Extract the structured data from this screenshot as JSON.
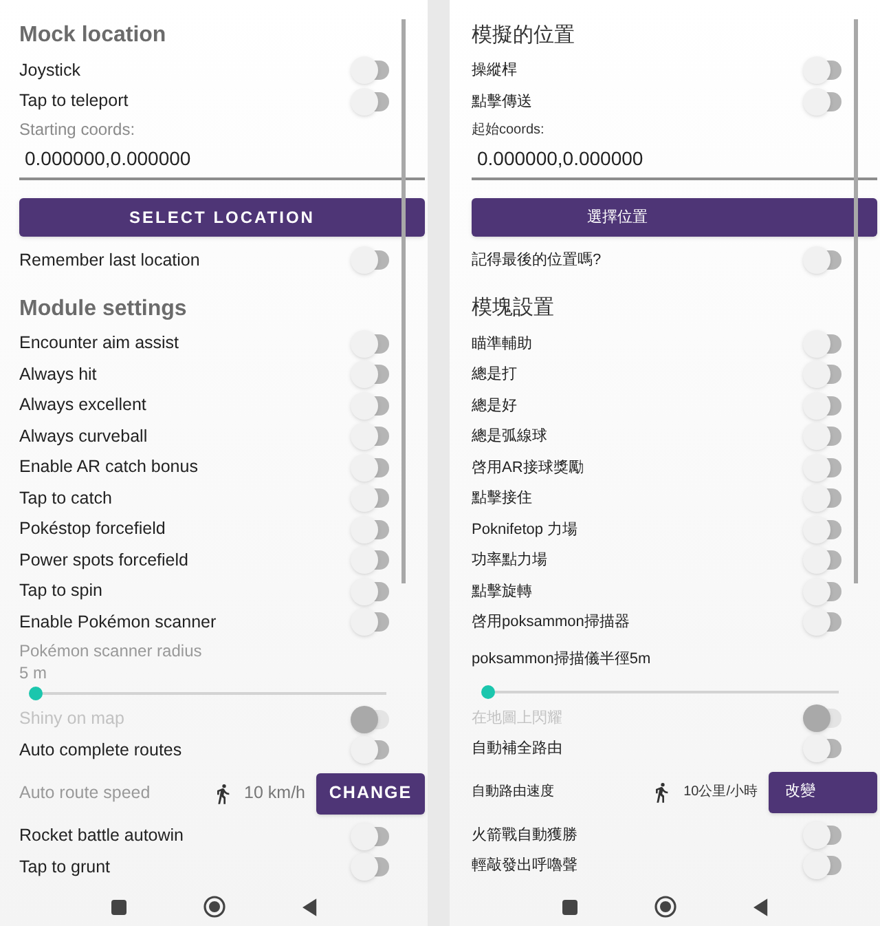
{
  "panels": [
    {
      "items": [
        {
          "kind": "header",
          "text": "Mock location"
        },
        {
          "kind": "toggle",
          "label": "Joystick",
          "on": false,
          "disabled": false
        },
        {
          "kind": "toggle",
          "label": "Tap to teleport",
          "on": false,
          "disabled": false
        },
        {
          "kind": "caption",
          "text": "Starting coords:"
        },
        {
          "kind": "input",
          "value": "0.000000,0.000000"
        },
        {
          "kind": "button",
          "label": "SELECT LOCATION"
        },
        {
          "kind": "toggle",
          "label": "Remember last location",
          "on": false,
          "disabled": false
        },
        {
          "kind": "header",
          "text": "Module settings"
        },
        {
          "kind": "toggle",
          "label": "Encounter aim assist",
          "on": false,
          "disabled": false
        },
        {
          "kind": "toggle",
          "label": "Always hit",
          "on": false,
          "disabled": false
        },
        {
          "kind": "toggle",
          "label": "Always excellent",
          "on": false,
          "disabled": false
        },
        {
          "kind": "toggle",
          "label": "Always curveball",
          "on": false,
          "disabled": false
        },
        {
          "kind": "toggle",
          "label": "Enable AR catch bonus",
          "on": false,
          "disabled": false
        },
        {
          "kind": "toggle",
          "label": "Tap to catch",
          "on": false,
          "disabled": false
        },
        {
          "kind": "toggle",
          "label": "Pokéstop forcefield",
          "on": false,
          "disabled": false
        },
        {
          "kind": "toggle",
          "label": "Power spots forcefield",
          "on": false,
          "disabled": false
        },
        {
          "kind": "toggle",
          "label": "Tap to spin",
          "on": false,
          "disabled": false
        },
        {
          "kind": "toggle",
          "label": "Enable Pokémon scanner",
          "on": false,
          "disabled": false
        },
        {
          "kind": "slider",
          "label": "Pokémon scanner radius",
          "value": "5 m",
          "level": 0
        },
        {
          "kind": "toggle",
          "label": "Shiny on map",
          "on": false,
          "disabled": true
        },
        {
          "kind": "toggle",
          "label": "Auto complete routes",
          "on": false,
          "disabled": false
        },
        {
          "kind": "speed",
          "label": "Auto route speed",
          "value": "10 km/h",
          "button": "CHANGE"
        },
        {
          "kind": "toggle",
          "label": "Rocket battle autowin",
          "on": false,
          "disabled": false
        },
        {
          "kind": "toggle",
          "label": "Tap to grunt",
          "on": false,
          "disabled": false
        }
      ]
    },
    {
      "items": [
        {
          "kind": "header",
          "text": "模擬的位置"
        },
        {
          "kind": "toggle",
          "label": "操縱桿",
          "on": false,
          "disabled": false
        },
        {
          "kind": "toggle",
          "label": "點擊傳送",
          "on": false,
          "disabled": false
        },
        {
          "kind": "caption",
          "text": "起始coords:"
        },
        {
          "kind": "input",
          "value": "0.000000,0.000000"
        },
        {
          "kind": "button",
          "label": "選擇位置"
        },
        {
          "kind": "toggle",
          "label": "記得最後的位置嗎?",
          "on": false,
          "disabled": false
        },
        {
          "kind": "header",
          "text": "模塊設置"
        },
        {
          "kind": "toggle",
          "label": "瞄準輔助",
          "on": false,
          "disabled": false
        },
        {
          "kind": "toggle",
          "label": "總是打",
          "on": false,
          "disabled": false
        },
        {
          "kind": "toggle",
          "label": "總是好",
          "on": false,
          "disabled": false
        },
        {
          "kind": "toggle",
          "label": "總是弧線球",
          "on": false,
          "disabled": false
        },
        {
          "kind": "toggle",
          "label": "啓用AR接球獎勵",
          "on": false,
          "disabled": false
        },
        {
          "kind": "toggle",
          "label": "點擊接住",
          "on": false,
          "disabled": false
        },
        {
          "kind": "toggle",
          "label": "Poknifetop 力場",
          "on": false,
          "disabled": false
        },
        {
          "kind": "toggle",
          "label": "功率點力場",
          "on": false,
          "disabled": false
        },
        {
          "kind": "toggle",
          "label": "點擊旋轉",
          "on": false,
          "disabled": false
        },
        {
          "kind": "toggle",
          "label": "啓用poksammon掃描器",
          "on": false,
          "disabled": false
        },
        {
          "kind": "slider",
          "label": "poksammon掃描儀半徑5m",
          "level": 0
        },
        {
          "kind": "toggle",
          "label": "在地圖上閃耀",
          "on": false,
          "disabled": true
        },
        {
          "kind": "toggle",
          "label": "自動補全路由",
          "on": false,
          "disabled": false
        },
        {
          "kind": "speed",
          "label": "自動路由速度",
          "value": "10公里/小時",
          "button": "改變"
        },
        {
          "kind": "toggle",
          "label": "火箭戰自動獲勝",
          "on": false,
          "disabled": false
        },
        {
          "kind": "toggle",
          "label": "輕敲發出呼嚕聲",
          "on": false,
          "disabled": false
        }
      ]
    }
  ]
}
